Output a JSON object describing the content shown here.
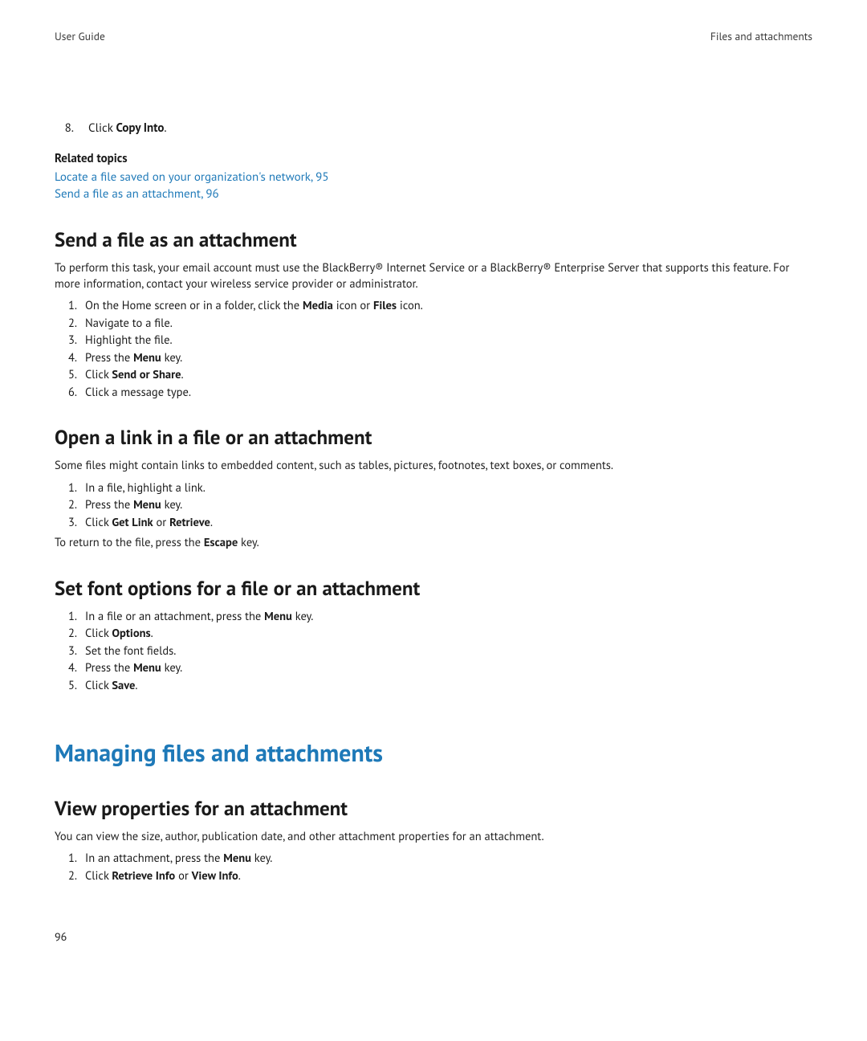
{
  "header": {
    "left": "User Guide",
    "right": "Files and attachments"
  },
  "topline": {
    "num": "8.",
    "pre": "Click ",
    "bold": "Copy Into",
    "post": "."
  },
  "related": {
    "heading": "Related topics",
    "links": [
      "Locate a file saved on your organization's network, 95",
      "Send a file as an attachment, 96"
    ]
  },
  "sec_send": {
    "title": "Send a file as an attachment",
    "intro": "To perform this task, your email account must use the BlackBerry® Internet Service or a BlackBerry® Enterprise Server that supports this feature. For more information, contact your wireless service provider or administrator.",
    "steps": [
      {
        "pre": "On the Home screen or in a folder, click the ",
        "b1": "Media",
        "mid": " icon or ",
        "b2": "Files",
        "post": " icon."
      },
      {
        "pre": "Navigate to a file."
      },
      {
        "pre": "Highlight the file."
      },
      {
        "pre": "Press the ",
        "b1": "Menu",
        "post": " key."
      },
      {
        "pre": "Click ",
        "b1": "Send or Share",
        "post": "."
      },
      {
        "pre": "Click a message type."
      }
    ]
  },
  "sec_open": {
    "title": "Open a link in a file or an attachment",
    "intro": "Some files might contain links to embedded content, such as tables, pictures, footnotes, text boxes, or comments.",
    "steps": [
      {
        "pre": "In a file, highlight a link."
      },
      {
        "pre": "Press the ",
        "b1": "Menu",
        "post": " key."
      },
      {
        "pre": "Click ",
        "b1": "Get Link",
        "mid": " or ",
        "b2": "Retrieve",
        "post": "."
      }
    ],
    "after_pre": "To return to the file, press the ",
    "after_bold": "Escape",
    "after_post": " key."
  },
  "sec_font": {
    "title": "Set font options for a file or an attachment",
    "steps": [
      {
        "pre": "In a file or an attachment, press the ",
        "b1": "Menu",
        "post": " key."
      },
      {
        "pre": "Click ",
        "b1": "Options",
        "post": "."
      },
      {
        "pre": "Set the font fields."
      },
      {
        "pre": "Press the ",
        "b1": "Menu",
        "post": " key."
      },
      {
        "pre": "Click ",
        "b1": "Save",
        "post": "."
      }
    ]
  },
  "chapter": {
    "title": "Managing files and attachments"
  },
  "sec_view": {
    "title": "View properties for an attachment",
    "intro": "You can view the size, author, publication date, and other attachment properties for an attachment.",
    "steps": [
      {
        "pre": "In an attachment, press the ",
        "b1": "Menu",
        "post": " key."
      },
      {
        "pre": "Click ",
        "b1": "Retrieve Info",
        "mid": " or ",
        "b2": "View Info",
        "post": "."
      }
    ]
  },
  "page_number": "96"
}
